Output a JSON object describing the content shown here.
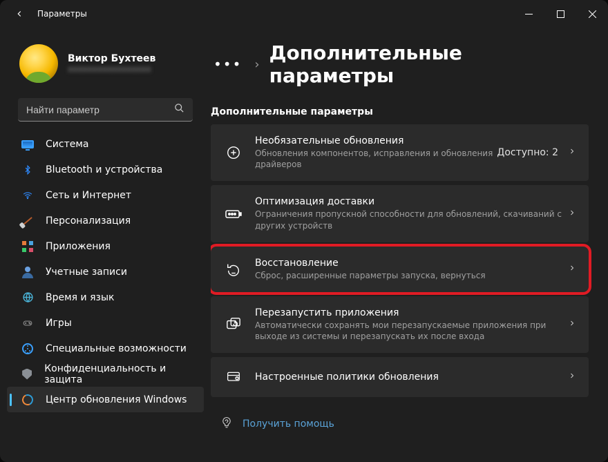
{
  "window": {
    "title": "Параметры"
  },
  "profile": {
    "name": "Виктор Бухтеев",
    "email_masked": "xxxxxxxxxxxxxxxxx"
  },
  "search": {
    "placeholder": "Найти параметр"
  },
  "sidebar": {
    "items": [
      {
        "label": "Система"
      },
      {
        "label": "Bluetooth и устройства"
      },
      {
        "label": "Сеть и Интернет"
      },
      {
        "label": "Персонализация"
      },
      {
        "label": "Приложения"
      },
      {
        "label": "Учетные записи"
      },
      {
        "label": "Время и язык"
      },
      {
        "label": "Игры"
      },
      {
        "label": "Специальные возможности"
      },
      {
        "label": "Конфиденциальность и защита"
      },
      {
        "label": "Центр обновления Windows"
      }
    ]
  },
  "breadcrumb": {
    "page_title": "Дополнительные параметры"
  },
  "section": {
    "label": "Дополнительные параметры"
  },
  "cards": [
    {
      "title": "Необязательные обновления",
      "desc": "Обновления компонентов, исправления и обновления драйверов",
      "right": "Доступно: 2"
    },
    {
      "title": "Оптимизация доставки",
      "desc": "Ограничения пропускной способности для обновлений, скачиваний с других устройств"
    },
    {
      "title": "Восстановление",
      "desc": "Сброс, расширенные параметры запуска, вернуться"
    },
    {
      "title": "Перезапустить приложения",
      "desc": "Автоматически сохранять мои перезапускаемые приложения при выходе из системы и перезапускать их после входа"
    },
    {
      "title": "Настроенные политики обновления",
      "desc": ""
    }
  ],
  "help": {
    "label": "Получить помощь"
  }
}
